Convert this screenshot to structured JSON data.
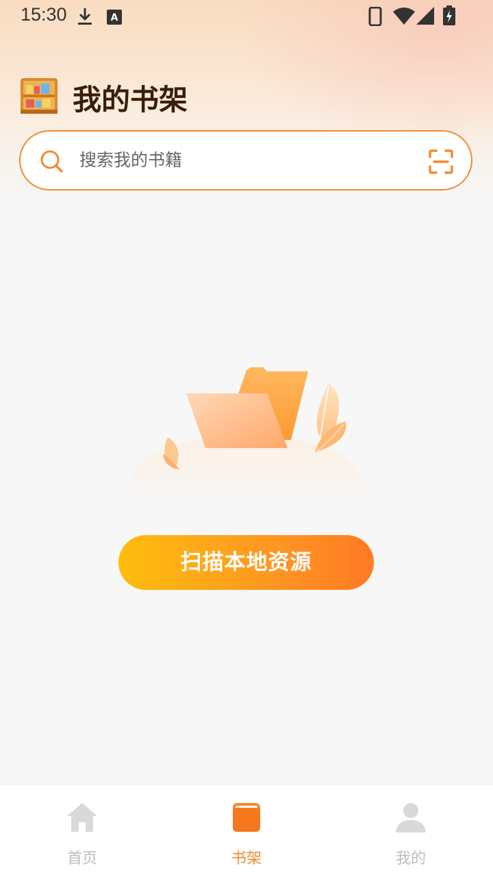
{
  "status_bar": {
    "time": "15:30",
    "left_icons": [
      "download-icon",
      "a-text-icon"
    ],
    "right_icons": [
      "phone-icon",
      "wifi-icon",
      "signal-icon",
      "battery-charging-icon"
    ]
  },
  "header": {
    "title": "我的书架",
    "icon": "bookshelf-icon"
  },
  "search": {
    "placeholder": "搜索我的书籍",
    "left_icon": "search-icon",
    "right_icon": "scan-icon"
  },
  "empty_state": {
    "illustration": "empty-folder-illustration",
    "button_label": "扫描本地资源"
  },
  "bottom_nav": {
    "items": [
      {
        "label": "首页",
        "icon": "home-icon",
        "active": false
      },
      {
        "label": "书架",
        "icon": "book-icon",
        "active": true
      },
      {
        "label": "我的",
        "icon": "user-icon",
        "active": false
      }
    ]
  },
  "colors": {
    "accent": "#f28a2e",
    "title": "#3a1e0a",
    "button_start": "#fdbd0e",
    "button_end": "#ff7a25",
    "inactive": "#bdbdbd"
  }
}
